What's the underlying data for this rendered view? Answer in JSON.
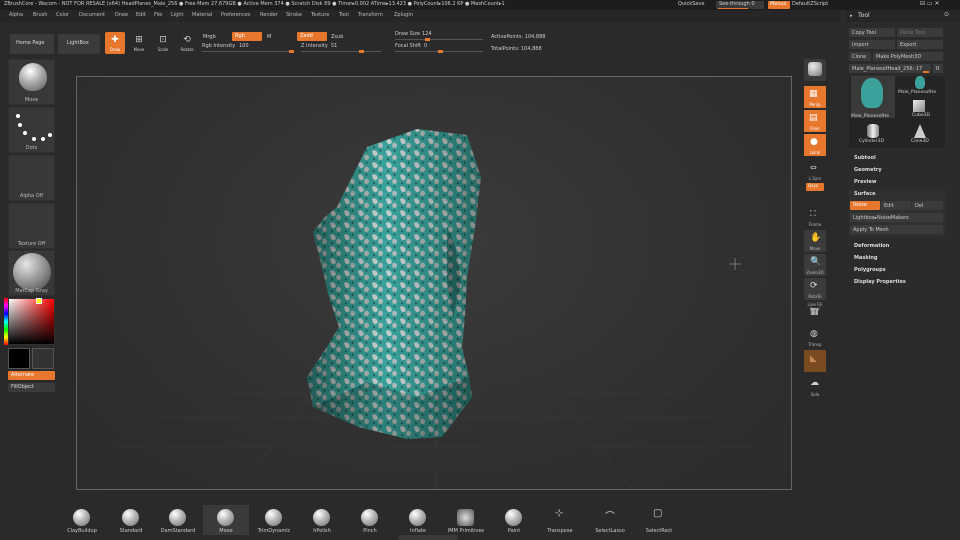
{
  "titlebar": {
    "title": "ZBrushCore - Wacom - NOT FOR RESALE (x64)    HeadPlanes_Male_256  ● Free Mem 27.679GB ● Active Mem 374 ● Scratch Disk 89 ● Timer▸0.002 ATime▸13.423 ● PolyCount▸106.2 KP ● MeshCount▸1",
    "quicksave": "QuickSave",
    "see_through": "See-through  0",
    "menus_button": "Menus",
    "default_zscript": "DefaultZScript",
    "window_controls": "⊟ ▭ ✕"
  },
  "menubar": [
    "Alpha",
    "Brush",
    "Color",
    "Document",
    "Draw",
    "Edit",
    "File",
    "Light",
    "Material",
    "Preferences",
    "Render",
    "Stroke",
    "Texture",
    "Tool",
    "Transform",
    "Zplugin"
  ],
  "toolbar": {
    "home_page": "Home Page",
    "lightbox": "LightBox",
    "draw": "Draw",
    "move": "Move",
    "scale": "Scale",
    "rotate": "Rotate",
    "mrgb": "Mrgb",
    "rgb": "Rgb",
    "m": "M",
    "rgb_intensity_label": "Rgb Intensity",
    "rgb_intensity_value": "100",
    "zadd": "Zadd",
    "zsub": "Zsub",
    "z_intensity_label": "Z Intensity",
    "z_intensity_value": "51",
    "draw_size_label": "Draw Size",
    "draw_size_value": "124",
    "focal_shift_label": "Focal Shift",
    "focal_shift_value": "0",
    "active_points": "ActivePoints: 104,888",
    "total_points": "TotalPoints: 104,888"
  },
  "left_shelf": {
    "brush": "Move",
    "stroke": "Dots",
    "alpha": "Alpha Off",
    "texture": "Texture Off",
    "material": "MatCap Gray",
    "alternate": "Alternate",
    "fill_object": "FillObject"
  },
  "right_shelf": [
    "Bpr",
    "Persp",
    "Floor",
    "Local",
    "L.Sym",
    "Qxyz",
    "Frame",
    "Move",
    "Zoom3D",
    "RotaTe",
    "Line Fill PolyF",
    "Transp",
    "",
    "Solo"
  ],
  "tool_panel": {
    "header": "Tool",
    "copy_tool": "Copy Tool",
    "paste_tool": "Paste Tool",
    "import": "Import",
    "export": "Export",
    "clone": "Clone",
    "make_polymesh": "Make PolyMesh3D",
    "current_tool": "Male_PlanesofHead_256: 17",
    "r_button": "R",
    "tools": [
      "Male_PlanesofHe",
      "Male_PlanesofHe",
      "Cube3D",
      "Cylinder3D",
      "Cone3D"
    ],
    "sections": {
      "subtool": "Subtool",
      "geometry": "Geometry",
      "preview": "Preview",
      "surface": "Surface",
      "deformation": "Deformation",
      "masking": "Masking",
      "polygroups": "Polygroups",
      "display_properties": "Display Properties"
    },
    "surface_none": "Noise",
    "surface_edit": "Edit",
    "surface_del": "Del",
    "lightbox_noise": "Lightbox▸NoiseMakers",
    "apply_to_mesh": "Apply To Mesh"
  },
  "brushes": [
    "ClayBuildup",
    "Standard",
    "DamStandard",
    "Move",
    "TrimDynamic",
    "hPolish",
    "Pinch",
    "Inflate",
    "IMM Primitives",
    "Paint",
    "Transpose",
    "SelectLasso",
    "SelectRect"
  ],
  "colors": {
    "accent": "#e8772e",
    "teal": "#3aa29a",
    "panel": "#2a2a2a"
  }
}
